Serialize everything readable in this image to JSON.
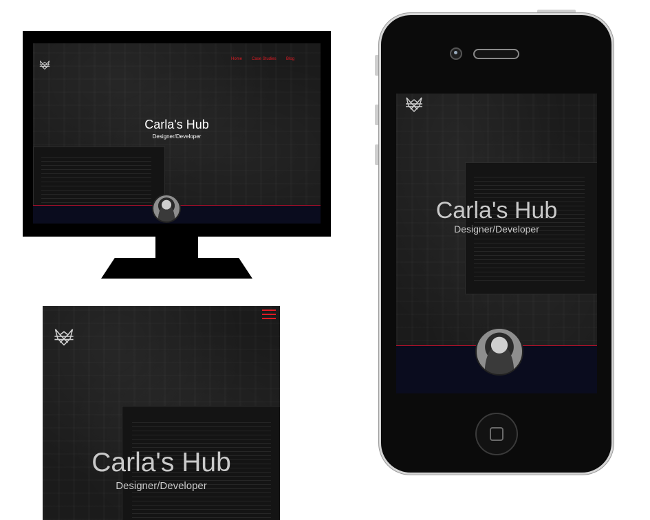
{
  "site": {
    "title": "Carla's Hub",
    "subtitle": "Designer/Developer",
    "nav": [
      "Home",
      "Case Studies",
      "Blog"
    ]
  },
  "icons": {
    "logo": "fox-logo-icon",
    "menu": "hamburger-menu-icon",
    "camera": "camera-icon",
    "home_button": "home-button-icon"
  },
  "colors": {
    "accent": "#e01b24",
    "hero_bg": "#1b1b1b",
    "strip": "#0a0c1e",
    "frame": "#000000"
  }
}
